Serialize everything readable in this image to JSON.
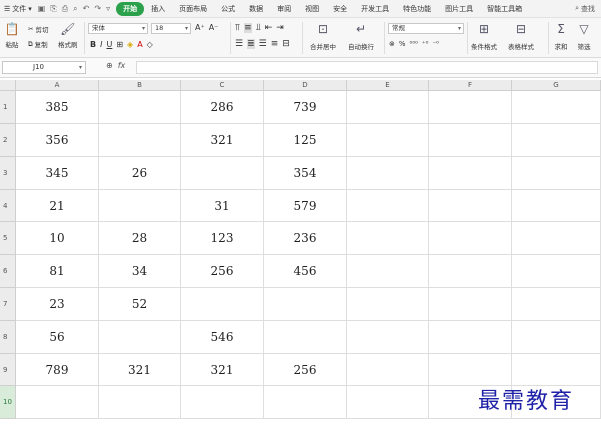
{
  "menubar": {
    "file_label": "文件",
    "tabs": [
      "开始",
      "插入",
      "页面布局",
      "公式",
      "数据",
      "审阅",
      "视图",
      "安全",
      "开发工具",
      "特色功能",
      "图片工具",
      "智能工具箱"
    ],
    "active_tab": "开始",
    "search_label": "查找"
  },
  "ribbon": {
    "paste": "粘贴",
    "cut": "剪切",
    "copy": "复制",
    "format_painter": "格式刷",
    "font_name": "宋体",
    "font_size": "18",
    "merge_center": "合并居中",
    "wrap_text": "自动换行",
    "number_format": "常规",
    "conditional_format": "条件格式",
    "table_style": "表格样式",
    "sum": "求和",
    "filter": "筛选"
  },
  "formulabar": {
    "name_box": "J10",
    "fx": "fx"
  },
  "sheet": {
    "columns": [
      "A",
      "B",
      "C",
      "D",
      "E",
      "F",
      "G"
    ],
    "rows": [
      {
        "n": "1",
        "cells": [
          "385",
          "",
          "286",
          "739",
          "",
          "",
          ""
        ]
      },
      {
        "n": "2",
        "cells": [
          "356",
          "",
          "321",
          "125",
          "",
          "",
          ""
        ]
      },
      {
        "n": "3",
        "cells": [
          "345",
          "26",
          "",
          "354",
          "",
          "",
          ""
        ]
      },
      {
        "n": "4",
        "cells": [
          "21",
          "",
          "31",
          "579",
          "",
          "",
          ""
        ]
      },
      {
        "n": "5",
        "cells": [
          "10",
          "28",
          "123",
          "236",
          "",
          "",
          ""
        ]
      },
      {
        "n": "6",
        "cells": [
          "81",
          "34",
          "256",
          "456",
          "",
          "",
          ""
        ]
      },
      {
        "n": "7",
        "cells": [
          "23",
          "52",
          "",
          "",
          "",
          "",
          ""
        ]
      },
      {
        "n": "8",
        "cells": [
          "56",
          "",
          "546",
          "",
          "",
          "",
          ""
        ]
      },
      {
        "n": "9",
        "cells": [
          "789",
          "321",
          "321",
          "256",
          "",
          "",
          ""
        ]
      },
      {
        "n": "10",
        "cells": [
          "",
          "",
          "",
          "",
          "",
          "",
          ""
        ]
      }
    ]
  },
  "watermark": "最需教育"
}
